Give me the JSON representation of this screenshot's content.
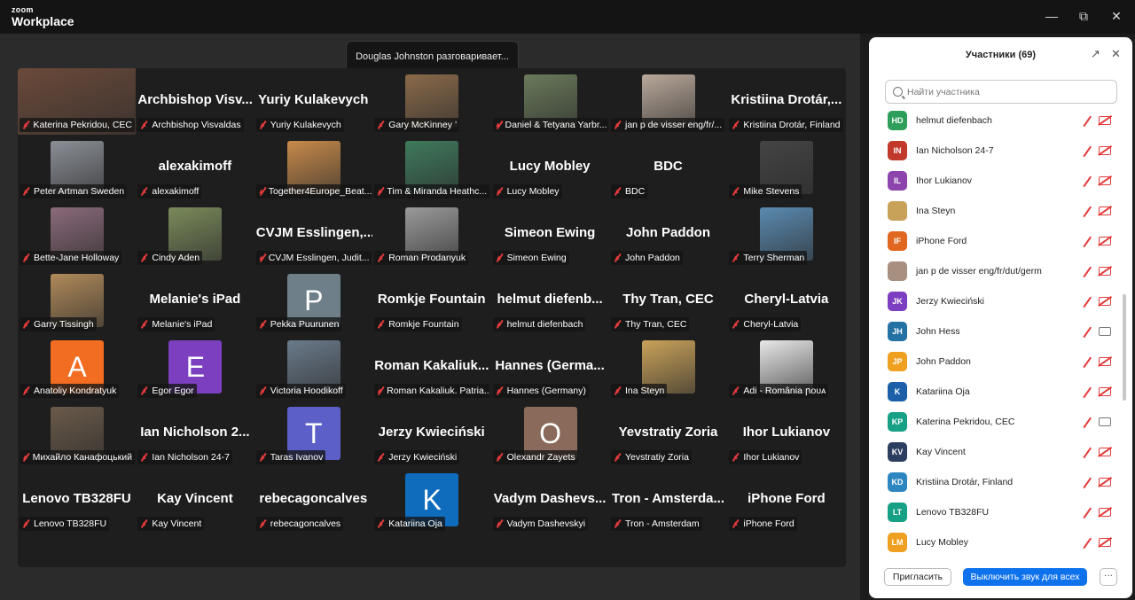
{
  "app": {
    "brand_small": "zoom",
    "brand_large": "Workplace"
  },
  "toast": "Douglas Johnston разговаривает...",
  "tiles": [
    {
      "bigname": "",
      "label": "Katerina Pekridou, CEC",
      "kind": "photo",
      "color": "#6b4a3a"
    },
    {
      "bigname": "Archbishop  Visv...",
      "label": "Archbishop Visvaldas",
      "kind": "name"
    },
    {
      "bigname": "Yuriy Kulakevych",
      "label": "Yuriy Kulakevych",
      "kind": "name"
    },
    {
      "bigname": "",
      "label": "Gary McKinney ’",
      "kind": "photo",
      "color": "#8a6a4a"
    },
    {
      "bigname": "",
      "label": "Daniel & Tetyana Yarbr...",
      "kind": "photo",
      "color": "#6a7a5a"
    },
    {
      "bigname": "",
      "label": "jan p de visser eng/fr/...",
      "kind": "photo",
      "color": "#b9a89a"
    },
    {
      "bigname": "Kristiina  Drotár,...",
      "label": "Kristiina Drotár, Finland",
      "kind": "name"
    },
    {
      "bigname": "",
      "label": "Peter Artman Sweden",
      "kind": "photo",
      "color": "#8b8f96"
    },
    {
      "bigname": "alexakimoff",
      "label": "alexakimoff",
      "kind": "name"
    },
    {
      "bigname": "",
      "label": "Together4Europe_Beat...",
      "kind": "photo",
      "color": "#c78a4a"
    },
    {
      "bigname": "",
      "label": "Tim & Miranda Heathc...",
      "kind": "photo",
      "color": "#3f7a5c"
    },
    {
      "bigname": "Lucy Mobley",
      "label": "Lucy Mobley",
      "kind": "name"
    },
    {
      "bigname": "BDC",
      "label": "BDC",
      "kind": "name"
    },
    {
      "bigname": "",
      "label": "Mike Stevens",
      "kind": "photo",
      "color": "#444444"
    },
    {
      "bigname": "",
      "label": "Bette-Jane Holloway",
      "kind": "photo",
      "color": "#8a6a7a"
    },
    {
      "bigname": "",
      "label": "Cindy Aden",
      "kind": "photo",
      "color": "#7a8a5a"
    },
    {
      "bigname": "CVJM  Esslingen,...",
      "label": "CVJM Esslingen,  Judit...",
      "kind": "name"
    },
    {
      "bigname": "",
      "label": "Roman Prodanyuk",
      "kind": "photo",
      "color": "#9a9a9a"
    },
    {
      "bigname": "Simeon Ewing",
      "label": "Simeon Ewing",
      "kind": "name"
    },
    {
      "bigname": "John Paddon",
      "label": "John Paddon",
      "kind": "name"
    },
    {
      "bigname": "",
      "label": "Terry Sherman",
      "kind": "photo",
      "color": "#5a8ab0"
    },
    {
      "bigname": "",
      "label": "Garry Tissingh",
      "kind": "photo",
      "color": "#b08a5a"
    },
    {
      "bigname": "Melanie's iPad",
      "label": "Melanie's iPad",
      "kind": "name"
    },
    {
      "bigname": "P",
      "label": "Pekka Puurunen",
      "kind": "letter",
      "color": "#6e7f8a"
    },
    {
      "bigname": "Romkje Fountain",
      "label": "Romkje Fountain",
      "kind": "name"
    },
    {
      "bigname": "helmut  diefenb...",
      "label": "helmut diefenbach",
      "kind": "name"
    },
    {
      "bigname": "Thy Tran, CEC",
      "label": "Thy Tran, CEC",
      "kind": "name"
    },
    {
      "bigname": "Cheryl-Latvia",
      "label": "Cheryl-Latvia",
      "kind": "name"
    },
    {
      "bigname": "A",
      "label": "Anatoliy Kondratyuk",
      "kind": "letter",
      "color": "#f26d21"
    },
    {
      "bigname": "E",
      "label": "Egor Egor",
      "kind": "letter",
      "color": "#7b3fbf"
    },
    {
      "bigname": "",
      "label": "Victoria Hoodikoff",
      "kind": "photo",
      "color": "#6a7a8a"
    },
    {
      "bigname": "Roman  Kakaliuk...",
      "label": "Roman Kakaliuk. Patria...",
      "kind": "name"
    },
    {
      "bigname": "Hannes  (Germa...",
      "label": "Hannes (Germany)",
      "kind": "name"
    },
    {
      "bigname": "",
      "label": "Ina Steyn",
      "kind": "photo",
      "color": "#c9a25a"
    },
    {
      "bigname": "",
      "label": "Adi - România ꞃoᴜᴀ",
      "kind": "photo",
      "color": "#e8e8e8"
    },
    {
      "bigname": "",
      "label": "Михайло Канафоцький",
      "kind": "photo",
      "color": "#6a5a4a"
    },
    {
      "bigname": "Ian  Nicholson  2...",
      "label": "Ian Nicholson 24-7",
      "kind": "name"
    },
    {
      "bigname": "T",
      "label": "Taras Ivanov",
      "kind": "letter",
      "color": "#5b5fc7"
    },
    {
      "bigname": "Jerzy Kwieciński",
      "label": "Jerzy Kwieciński",
      "kind": "name"
    },
    {
      "bigname": "O",
      "label": "Olexandr Zayets",
      "kind": "letter",
      "color": "#8a6a5a"
    },
    {
      "bigname": "Yevstratiy Zoria",
      "label": "Yevstratiy Zoria",
      "kind": "name"
    },
    {
      "bigname": "Ihor Lukianov",
      "label": "Ihor Lukianov",
      "kind": "name"
    },
    {
      "bigname": "Lenovo TB328FU",
      "label": "Lenovo TB328FU",
      "kind": "name"
    },
    {
      "bigname": "Kay Vincent",
      "label": "Kay Vincent",
      "kind": "name"
    },
    {
      "bigname": "rebecagoncalves",
      "label": "rebecagoncalves",
      "kind": "name"
    },
    {
      "bigname": "K",
      "label": "Katariina Oja",
      "kind": "letter",
      "color": "#0f6cbd"
    },
    {
      "bigname": "Vadym  Dashevs...",
      "label": "Vadym Dashevskyi",
      "kind": "name"
    },
    {
      "bigname": "Tron  -  Amsterda...",
      "label": "Tron - Amsterdam",
      "kind": "name"
    },
    {
      "bigname": "iPhone Ford",
      "label": "iPhone Ford",
      "kind": "name"
    }
  ],
  "panel": {
    "title": "Участники (69)",
    "search_placeholder": "Найти участника",
    "invite": "Пригласить",
    "mute_all": "Выключить звук для всех",
    "more": "···",
    "participants": [
      {
        "initials": "HD",
        "name": "helmut diefenbach",
        "color": "#2e9e5b",
        "cam": "off"
      },
      {
        "initials": "IN",
        "name": "Ian Nicholson 24-7",
        "color": "#c0392b",
        "cam": "off"
      },
      {
        "initials": "IL",
        "name": "Ihor Lukianov",
        "color": "#8e44ad",
        "cam": "off"
      },
      {
        "initials": "",
        "name": "Ina Steyn",
        "color": "#c9a25a",
        "cam": "off"
      },
      {
        "initials": "IF",
        "name": "iPhone Ford",
        "color": "#e0671f",
        "cam": "off"
      },
      {
        "initials": "",
        "name": "jan p de visser eng/fr/dut/germ",
        "color": "#a89080",
        "cam": "off"
      },
      {
        "initials": "JK",
        "name": "Jerzy Kwieciński",
        "color": "#7d3fc1",
        "cam": "off"
      },
      {
        "initials": "JH",
        "name": "John Hess",
        "color": "#2471a3",
        "cam": "on"
      },
      {
        "initials": "JP",
        "name": "John Paddon",
        "color": "#f0a020",
        "cam": "off"
      },
      {
        "initials": "K",
        "name": "Katariina Oja",
        "color": "#1a5fa8",
        "cam": "off"
      },
      {
        "initials": "KP",
        "name": "Katerina Pekridou, CEC",
        "color": "#17a085",
        "cam": "on"
      },
      {
        "initials": "KV",
        "name": "Kay Vincent",
        "color": "#2c3e60",
        "cam": "off"
      },
      {
        "initials": "KD",
        "name": "Kristiina Drotár, Finland",
        "color": "#2e86c1",
        "cam": "off"
      },
      {
        "initials": "LT",
        "name": "Lenovo TB328FU",
        "color": "#16a085",
        "cam": "off"
      },
      {
        "initials": "LM",
        "name": "Lucy Mobley",
        "color": "#f0a020",
        "cam": "off"
      }
    ]
  }
}
